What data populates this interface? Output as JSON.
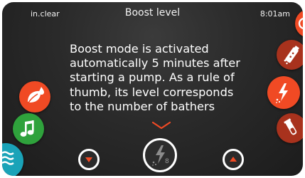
{
  "status": {
    "left_label": "in.clear",
    "time": "8:01am"
  },
  "header": {
    "title": "Boost level"
  },
  "main": {
    "message_lines": [
      "Boost mode is activated",
      "automatically 5 minutes after",
      "starting a pump. As a rule of",
      "thumb, its level corresponds",
      "to the number of bathers"
    ]
  },
  "controls": {
    "boost_level": "8"
  },
  "left_menu": {
    "icons": [
      "leaf-drop-icon",
      "music-note-icon",
      "waves-icon"
    ]
  },
  "right_menu": {
    "icons": [
      "top-partial-icon",
      "salt-cartridge-icon",
      "boost-bolt-icon",
      "test-tube-icon"
    ]
  },
  "colors": {
    "accent_orange": "#f04a24",
    "accent_green": "#2fa23c",
    "accent_teal": "#1aa3b8",
    "dark_red": "#a8321d",
    "text": "#ffffff"
  }
}
